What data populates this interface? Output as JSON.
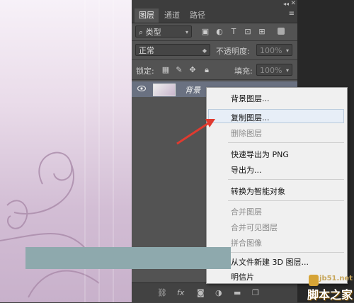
{
  "panel": {
    "tabs": [
      "图层",
      "通道",
      "路径"
    ],
    "filter_label": "类型",
    "blend_mode": "正常",
    "opacity_label": "不透明度:",
    "opacity_value": "100%",
    "lock_label": "锁定:",
    "fill_label": "填充:",
    "fill_value": "100%",
    "layer_name": "背景",
    "bottom_fx": "fx"
  },
  "context_menu": {
    "items": [
      {
        "label": "背景图层...",
        "enabled": true
      },
      {
        "label": "复制图层...",
        "enabled": true,
        "highlighted": true
      },
      {
        "label": "删除图层",
        "enabled": false
      },
      {
        "label": "快速导出为 PNG",
        "enabled": true
      },
      {
        "label": "导出为...",
        "enabled": true
      },
      {
        "label": "转换为智能对象",
        "enabled": true
      },
      {
        "label": "合并图层",
        "enabled": false
      },
      {
        "label": "合并可见图层",
        "enabled": false
      },
      {
        "label": "拼合图像",
        "enabled": false
      },
      {
        "label": "从文件新建 3D 图层...",
        "enabled": true
      },
      {
        "label": "明信片",
        "enabled": true
      }
    ]
  },
  "watermark": {
    "site": "jb51.net",
    "name": "脚本之家"
  },
  "colors": {
    "arrow": "#e03a2f",
    "highlight": "#e7eef7",
    "selected_layer": "#6a7181"
  }
}
